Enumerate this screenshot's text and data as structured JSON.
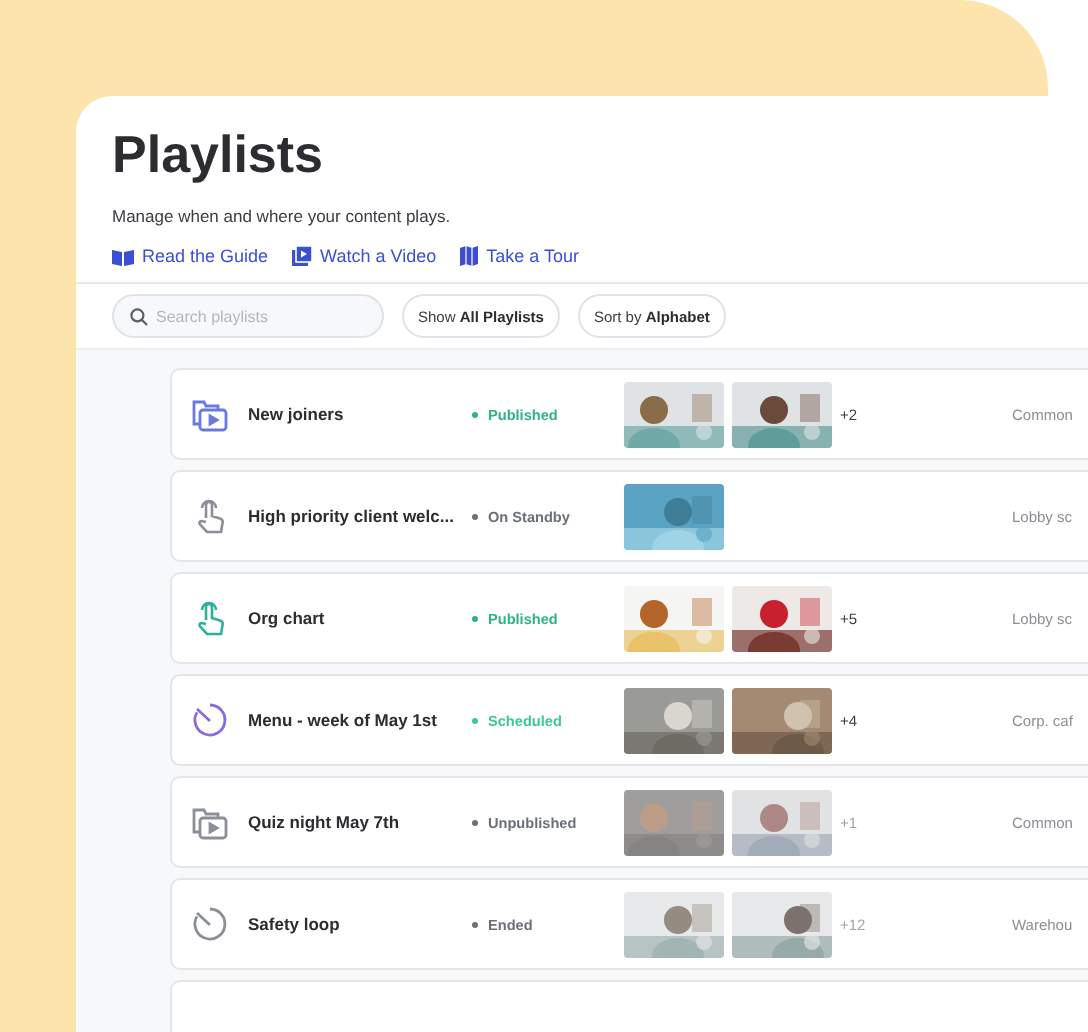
{
  "title": "Playlists",
  "subtitle": "Manage when and where your content plays.",
  "links": [
    {
      "kind": "book",
      "label": "Read the Guide"
    },
    {
      "kind": "video",
      "label": "Watch a Video"
    },
    {
      "kind": "map",
      "label": "Take a Tour"
    }
  ],
  "search": {
    "placeholder": "Search playlists"
  },
  "filters": [
    {
      "prefix": "Show",
      "value": "All Playlists"
    },
    {
      "prefix": "Sort by",
      "value": "Alphabet"
    }
  ],
  "rows": [
    {
      "icon": {
        "kind": "playlist",
        "color": "#6b78e0"
      },
      "name": "New joiners",
      "status": {
        "label": "Published",
        "color": "#2fb383"
      },
      "muted": false,
      "more": "+2",
      "location": "Common"
    },
    {
      "icon": {
        "kind": "touch",
        "color": "#8a8f98"
      },
      "name": "High priority client welc...",
      "status": {
        "label": "On Standby",
        "color": "#6b7078"
      },
      "muted": false,
      "location": "Lobby sc"
    },
    {
      "icon": {
        "kind": "touch",
        "color": "#2bb39a"
      },
      "name": "Org chart",
      "status": {
        "label": "Published",
        "color": "#2fb383"
      },
      "muted": false,
      "more": "+5",
      "location": "Lobby sc"
    },
    {
      "icon": {
        "kind": "clock",
        "color": "#8a6be0"
      },
      "name": "Menu - week of May 1st",
      "status": {
        "label": "Scheduled",
        "color": "#3cc79a"
      },
      "muted": false,
      "more": "+4",
      "location": "Corp. caf"
    },
    {
      "icon": {
        "kind": "playlist",
        "color": "#8a8f98"
      },
      "name": "Quiz night May 7th",
      "status": {
        "label": "Unpublished",
        "color": "#6b7078"
      },
      "muted": true,
      "more": "+1",
      "location": "Common"
    },
    {
      "icon": {
        "kind": "clock",
        "color": "#8a8f98"
      },
      "name": "Safety loop",
      "status": {
        "label": "Ended",
        "color": "#6b7078"
      },
      "muted": true,
      "more": "+12",
      "location": "Warehou"
    }
  ]
}
